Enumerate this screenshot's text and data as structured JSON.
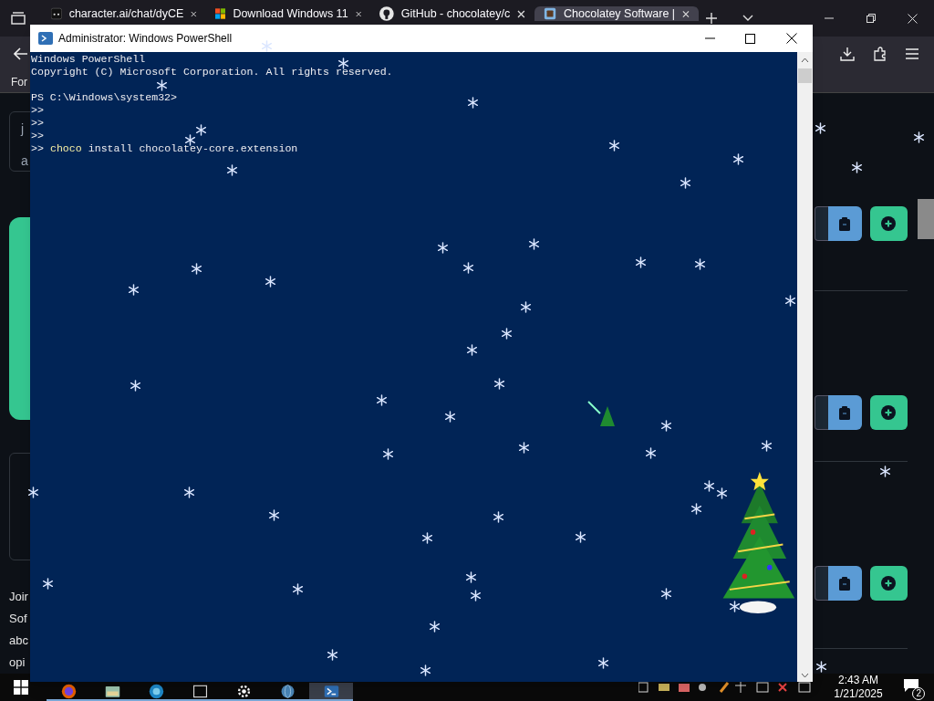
{
  "browser": {
    "tabs": [
      {
        "kind": "chat",
        "label": "character.ai/chat/dyCE",
        "selected": false
      },
      {
        "kind": "windows",
        "label": "Download Windows 11",
        "selected": false
      },
      {
        "kind": "github",
        "label": "GitHub - chocolatey/c",
        "selected": false
      },
      {
        "kind": "chocolatey",
        "label": "Chocolatey Software |",
        "selected": true
      }
    ],
    "page_fragments": [
      {
        "kind": "bookmark",
        "text": "For"
      },
      {
        "kind": "card",
        "text": "j"
      },
      {
        "kind": "card",
        "text": "a"
      },
      {
        "kind": "paragraph",
        "text": "Joir"
      },
      {
        "kind": "paragraph",
        "text": "Sof"
      },
      {
        "kind": "paragraph",
        "text": "abc"
      },
      {
        "kind": "paragraph",
        "text": "opi"
      }
    ]
  },
  "powershell": {
    "title": "Administrator: Windows PowerShell",
    "lines": [
      {
        "kind": "text",
        "text": "Windows PowerShell"
      },
      {
        "kind": "text",
        "text": "Copyright (C) Microsoft Corporation. All rights reserved."
      },
      {
        "kind": "blank"
      },
      {
        "kind": "text",
        "text": "PS C:\\Windows\\system32>"
      },
      {
        "kind": "text",
        "text": ">>"
      },
      {
        "kind": "text",
        "text": ">>"
      },
      {
        "kind": "text",
        "text": ">>"
      },
      {
        "kind": "command",
        "prompt": ">>",
        "program": "choco",
        "args": "install chocolatey-core.extension"
      }
    ]
  },
  "taskbar": {
    "apps": [
      {
        "kind": "firefox",
        "active": false
      },
      {
        "kind": "files",
        "active": false
      },
      {
        "kind": "edge",
        "active": false
      },
      {
        "kind": "terminal",
        "active": false
      },
      {
        "kind": "settings",
        "active": false
      },
      {
        "kind": "globe",
        "active": false
      },
      {
        "kind": "powershell",
        "active": true
      }
    ],
    "time": "2:43 AM",
    "date": "1/21/2025",
    "notifications": "2"
  }
}
